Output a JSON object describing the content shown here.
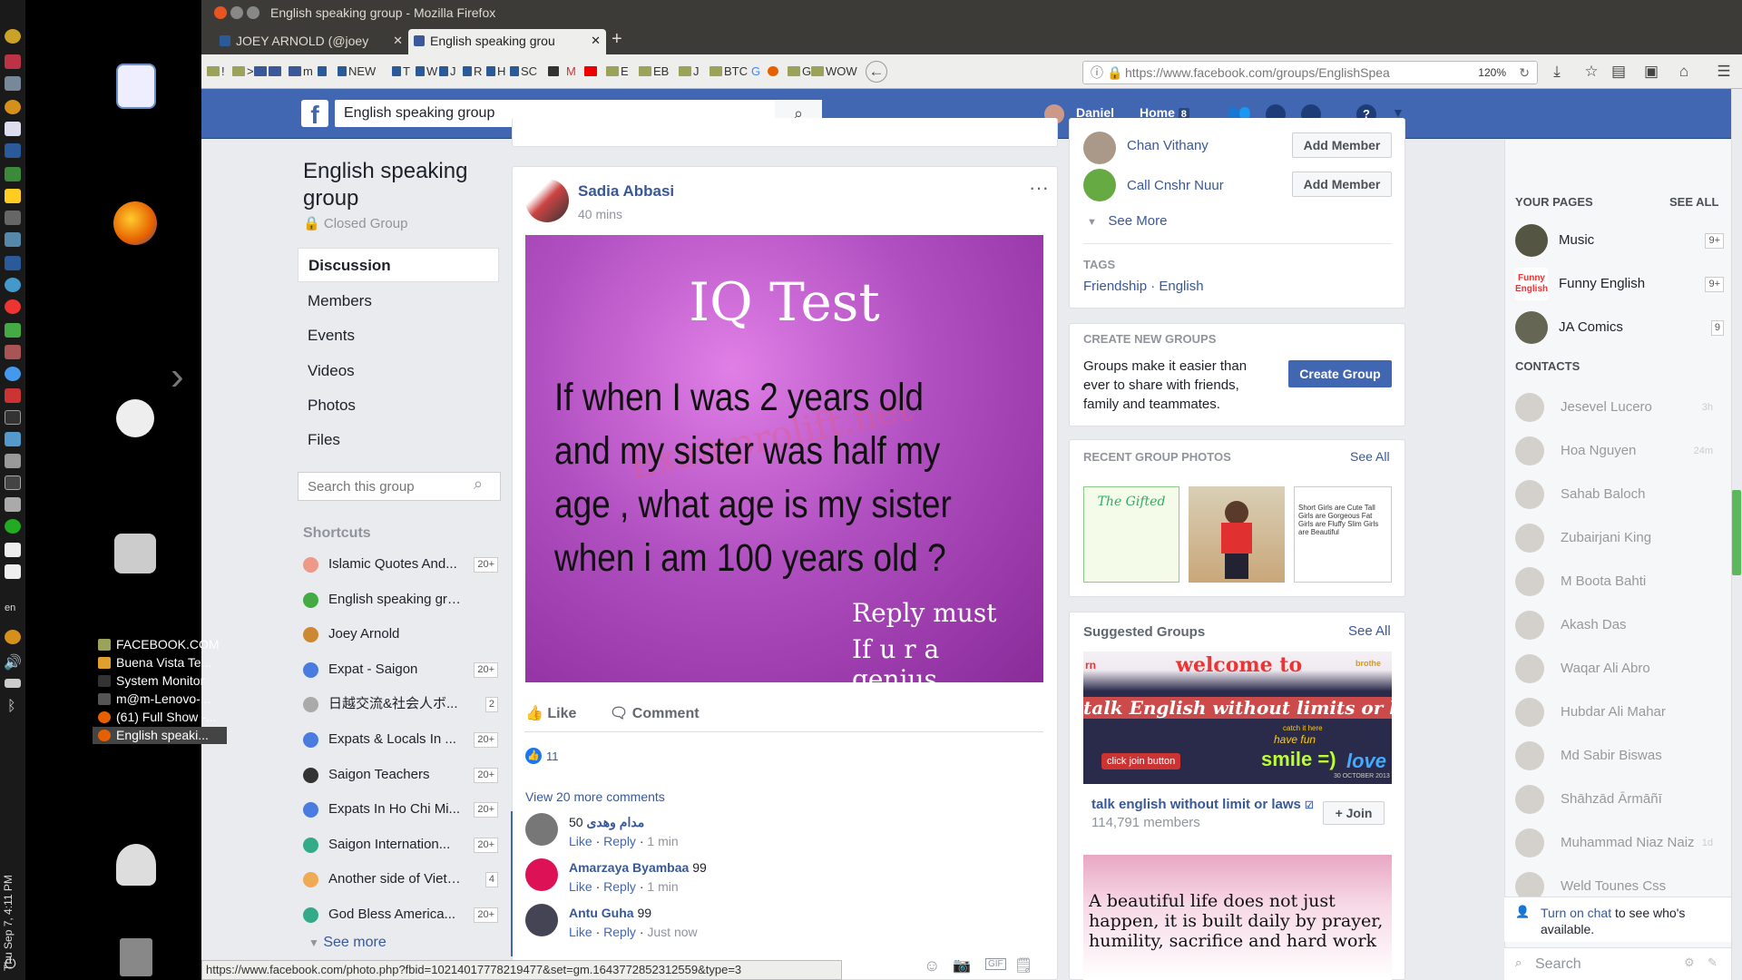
{
  "window": {
    "title": "English speaking group - Mozilla Firefox"
  },
  "tabs": [
    {
      "label": "JOEY ARNOLD (@joey"
    },
    {
      "label": "English speaking grou"
    }
  ],
  "bookmarks": [
    "!",
    ">",
    "m",
    "NEW",
    "T",
    "W",
    "J",
    "R",
    "H",
    "SC",
    "E",
    "EB",
    "J",
    "BTC",
    "G",
    "G",
    "WOW"
  ],
  "url": "https://www.facebook.com/groups/EnglishSpea",
  "zoom": "120%",
  "launcher_time": "Thu Sep 7, 4:11 PM",
  "launcher_lang": "en",
  "windows_list": [
    "FACEBOOK.COM",
    "Buena Vista Te...",
    "System Monitor",
    "m@m-Lenovo-...",
    "(61) Full Show -...",
    "English speaki..."
  ],
  "fb": {
    "search_value": "English speaking group",
    "user": "Daniel",
    "home": "Home",
    "home_count": "8"
  },
  "group": {
    "title": "English speaking group",
    "privacy": "Closed Group",
    "nav": [
      "Discussion",
      "Members",
      "Events",
      "Videos",
      "Photos",
      "Files"
    ],
    "search_placeholder": "Search this group",
    "shortcuts_title": "Shortcuts",
    "shortcuts": [
      {
        "name": "Islamic Quotes And...",
        "badge": "20+"
      },
      {
        "name": "English speaking group",
        "badge": ""
      },
      {
        "name": "Joey Arnold",
        "badge": ""
      },
      {
        "name": "Expat - Saigon",
        "badge": "20+"
      },
      {
        "name": "日越交流&社会人ボ...",
        "badge": "2"
      },
      {
        "name": "Expats & Locals In ...",
        "badge": "20+"
      },
      {
        "name": "Saigon Teachers",
        "badge": "20+"
      },
      {
        "name": "Expats In Ho Chi Mi...",
        "badge": "20+"
      },
      {
        "name": "Saigon Internation...",
        "badge": "20+"
      },
      {
        "name": "Another side of Vietn...",
        "badge": "4"
      },
      {
        "name": "God Bless America...",
        "badge": "20+"
      }
    ],
    "see_more": "See more"
  },
  "post": {
    "author": "Sadia Abbasi",
    "time": "40 mins",
    "image": {
      "title": "IQ Test",
      "body": "If when I was 2 years old and my sister was half my age , what age is my sister when i am 100 years old ?",
      "reply1": "Reply must",
      "reply2": "If u r a genius..",
      "watermark": "Examprolift.net"
    },
    "like": "Like",
    "comment": "Comment",
    "reactions": "11",
    "view_more": "View 20 more comments",
    "comments": [
      {
        "name": "مدام وهدى",
        "text": "50",
        "like": "Like",
        "reply": "Reply",
        "time": "1 min"
      },
      {
        "name": "Amarzaya Byambaa",
        "text": "99",
        "like": "Like",
        "reply": "Reply",
        "time": "1 min"
      },
      {
        "name": "Antu Guha",
        "text": "99",
        "like": "Like",
        "reply": "Reply",
        "time": "Just now"
      }
    ]
  },
  "members": [
    {
      "name": "Chan Vithany",
      "btn": "Add Member"
    },
    {
      "name": "Call Cnshr Nuur",
      "btn": "Add Member"
    }
  ],
  "see_more_members": "See More",
  "tags": {
    "title": "TAGS",
    "items": "Friendship · English"
  },
  "create_groups": {
    "title": "CREATE NEW GROUPS",
    "text": "Groups make it easier than ever to share with friends, family and teammates.",
    "btn": "Create Group"
  },
  "recent_photos": {
    "title": "RECENT GROUP PHOTOS",
    "see_all": "See All",
    "p1": "The Gifted",
    "p3": "Short Girls are Cute Tall Girls are Gorgeous Fat Girls are Fluffy Slim Girls are Beautiful"
  },
  "suggested": {
    "title": "Suggested Groups",
    "see_all": "See All",
    "banner_top": "welcome to",
    "banner_main": "talk English without limits or laws",
    "banner_smile": "smile =)",
    "banner_love": "love",
    "banner_btn": "click join button",
    "banner_mid": "have fun",
    "banner_left": "rn",
    "banner_right": "brothe",
    "banner_date": "30 OCTOBER 2013",
    "banner_small": "catch it here",
    "name": "talk english without limit or laws",
    "members": "114,791 members",
    "join": "Join",
    "banner2": "A beautiful life does not just happen, it is built daily by prayer, humility, sacrifice and hard work"
  },
  "your_pages": {
    "title": "YOUR PAGES",
    "see_all": "SEE ALL",
    "items": [
      {
        "name": "Music",
        "badge": "9+"
      },
      {
        "name": "Funny English",
        "badge": "9+"
      },
      {
        "name": "JA Comics",
        "badge": "9"
      }
    ]
  },
  "funny_logo": "Funny English",
  "contacts": {
    "title": "CONTACTS",
    "items": [
      {
        "name": "Jesevel Lucero",
        "time": "3h"
      },
      {
        "name": "Hoa Nguyen",
        "time": "24m"
      },
      {
        "name": "Sahab Baloch",
        "time": ""
      },
      {
        "name": "Zubairjani King",
        "time": ""
      },
      {
        "name": "M Boota Bahti",
        "time": ""
      },
      {
        "name": "Akash Das",
        "time": ""
      },
      {
        "name": "Waqar Ali Abro",
        "time": ""
      },
      {
        "name": "Hubdar Ali Mahar",
        "time": ""
      },
      {
        "name": "Md Sabir Biswas",
        "time": ""
      },
      {
        "name": "Shāhzād Ārmāñī",
        "time": ""
      },
      {
        "name": "Muhammad Niaz Naiz",
        "time": "1d"
      },
      {
        "name": "Weld Tounes Css",
        "time": ""
      }
    ]
  },
  "chat": {
    "link": "Turn on chat",
    "rest": "to see who's available.",
    "search": "Search"
  },
  "status_url": "https://www.facebook.com/photo.php?fbid=10214017778219477&set=gm.1643772852312559&type=3",
  "colors": {
    "fb_blue": "#4267b2",
    "link": "#385898",
    "bg": "#e9ebee"
  }
}
